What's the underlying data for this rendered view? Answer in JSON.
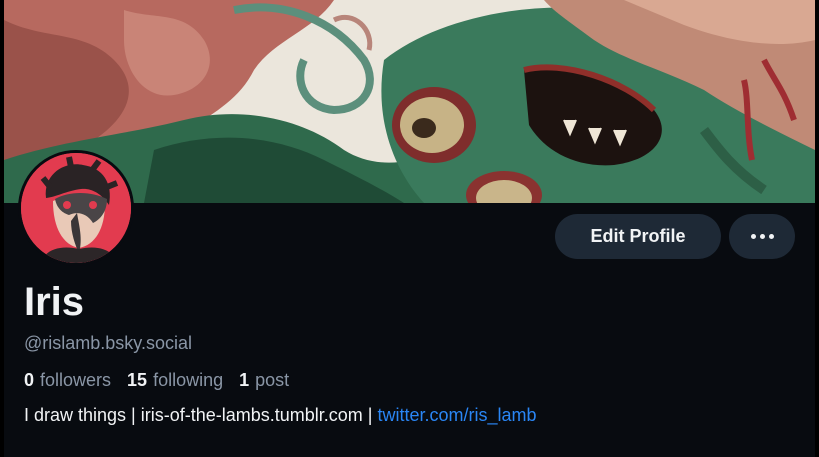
{
  "profile": {
    "display_name": "Iris",
    "handle": "@rislamb.bsky.social",
    "stats": {
      "followers_count": "0",
      "followers_label": "followers",
      "following_count": "15",
      "following_label": "following",
      "posts_count": "1",
      "posts_label": "post"
    },
    "bio": {
      "text": "I draw things | iris-of-the-lambs.tumblr.com | ",
      "link": "twitter.com/ris_lamb"
    }
  },
  "actions": {
    "edit_profile_label": "Edit Profile",
    "more_icon": "ellipsis-icon"
  },
  "colors": {
    "background": "#080b10",
    "button_bg": "#1e2936",
    "text_primary": "#f1f3f5",
    "text_secondary": "#8a96a6",
    "link": "#2a86f5",
    "avatar_bg": "#e23b4f"
  }
}
